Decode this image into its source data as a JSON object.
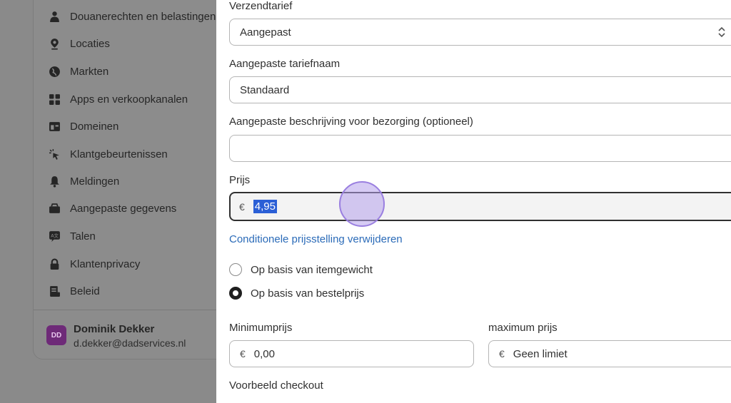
{
  "sidebar": {
    "items": [
      {
        "label": "Douanerechten en belastingen",
        "icon": "person-tax-icon"
      },
      {
        "label": "Locaties",
        "icon": "location-pin-icon"
      },
      {
        "label": "Markten",
        "icon": "globe-icon"
      },
      {
        "label": "Apps en verkoopkanalen",
        "icon": "apps-grid-icon"
      },
      {
        "label": "Domeinen",
        "icon": "domain-icon"
      },
      {
        "label": "Klantgebeurtenissen",
        "icon": "cursor-click-icon"
      },
      {
        "label": "Meldingen",
        "icon": "bell-icon"
      },
      {
        "label": "Aangepaste gegevens",
        "icon": "database-icon"
      },
      {
        "label": "Talen",
        "icon": "language-icon"
      },
      {
        "label": "Klantenprivacy",
        "icon": "lock-icon"
      },
      {
        "label": "Beleid",
        "icon": "policy-icon"
      }
    ],
    "user": {
      "initials": "DD",
      "name": "Dominik Dekker",
      "email": "d.dekker@dadservices.nl"
    }
  },
  "form": {
    "shipping_rate_label": "Verzendtarief",
    "shipping_rate_value": "Aangepast",
    "custom_rate_name_label": "Aangepaste tariefnaam",
    "custom_rate_name_value": "Standaard",
    "custom_description_label": "Aangepaste beschrijving voor bezorging (optioneel)",
    "custom_description_value": "",
    "price_label": "Prijs",
    "currency_symbol": "€",
    "price_value": "4,95",
    "remove_conditional_link": "Conditionele prijsstelling verwijderen",
    "radio_weight_label": "Op basis van itemgewicht",
    "radio_order_label": "Op basis van bestelprijs",
    "selected_radio": "Op basis van bestelprijs",
    "min_price_label": "Minimumprijs",
    "min_price_value": "0,00",
    "max_price_label": "maximum prijs",
    "max_price_value": "Geen limiet",
    "checkout_preview_label": "Voorbeeld checkout"
  },
  "colors": {
    "accent_link": "#2b6bb8",
    "selection": "#2b5fd6",
    "avatar": "#6e2a78",
    "cursor_highlight": "#b4a0eb"
  }
}
